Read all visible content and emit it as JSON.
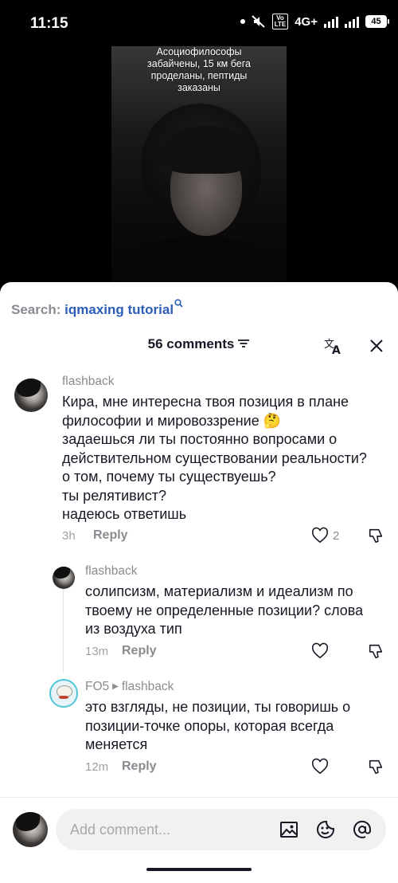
{
  "status_bar": {
    "time": "11:15",
    "network": "4G+",
    "volte_top": "Vo",
    "volte_bottom": "LTE",
    "battery": "45"
  },
  "video": {
    "caption": "Асоциофилософы\nзабайчены, 15 км бега\nпроделаны, пептиды\nзаказаны"
  },
  "search": {
    "label": "Search:",
    "term": "iqmaxing tutorial"
  },
  "header": {
    "title": "56 comments"
  },
  "comments": [
    {
      "username": "flashback",
      "text": "Кира, мне интересна твоя позиция в плане\nфилософии и мировоззрение 🤔\nзадаешься ли ты постоянно вопросами о\nдействительном существовании реальности?\nо том, почему ты существуешь?\nты релятивист?\nнадеюсь ответишь",
      "time": "3h",
      "reply_label": "Reply",
      "likes": "2"
    },
    {
      "username": "flashback",
      "text": "солипсизм, материализм и идеализм по\nтвоему не определенные позиции? слова\nиз воздуха тип",
      "time": "13m",
      "reply_label": "Reply",
      "likes": ""
    },
    {
      "username": "FO5",
      "reply_to": "flashback",
      "text": "это взгляды, не позиции, ты говоришь о\nпозиции-точке опоры, которая всегда\nменяется",
      "time": "12m",
      "reply_label": "Reply",
      "likes": ""
    }
  ],
  "input": {
    "placeholder": "Add comment..."
  },
  "icons": {
    "search": "search-icon",
    "filter": "filter-icon",
    "translate": "translate-icon",
    "close": "close-icon",
    "like": "heart-icon",
    "dislike": "thumbs-down-icon",
    "image": "image-icon",
    "emoji": "emoji-icon",
    "mention": "at-icon"
  },
  "colors": {
    "search_term": "#2b5db9",
    "muted": "#8a8b91",
    "text": "#161823",
    "sheet": "#ffffff"
  }
}
